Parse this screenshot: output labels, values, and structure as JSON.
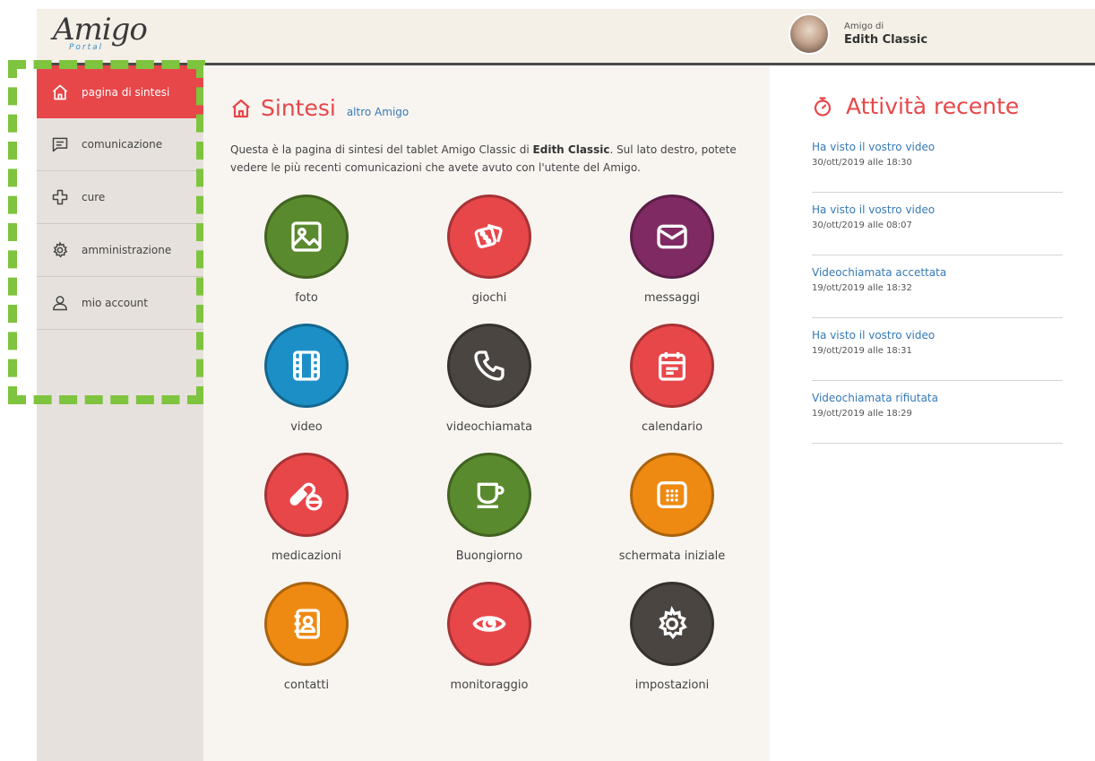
{
  "brand": {
    "logo": "Amigo",
    "sub": "Portal"
  },
  "user": {
    "label": "Amigo di",
    "name": "Edith Classic"
  },
  "sidebar": {
    "items": [
      {
        "label": "pagina di sintesi",
        "icon": "home-icon"
      },
      {
        "label": "comunicazione",
        "icon": "chat-icon"
      },
      {
        "label": "cure",
        "icon": "care-icon"
      },
      {
        "label": "amministrazione",
        "icon": "gear-icon"
      },
      {
        "label": "mio account",
        "icon": "user-icon"
      }
    ]
  },
  "main": {
    "title": "Sintesi",
    "title_link": "altro Amigo",
    "intro_part1": "Questa è la pagina di sintesi del tablet Amigo Classic di ",
    "intro_bold": "Edith Classic",
    "intro_part2": ". Sul lato destro, potete vedere le più recenti comunicazioni che avete avuto con l'utente del Amigo.",
    "tiles": [
      {
        "label": "foto",
        "color": "#5a8a2e",
        "icon": "photo-icon"
      },
      {
        "label": "giochi",
        "color": "#e8474a",
        "icon": "dice-icon"
      },
      {
        "label": "messaggi",
        "color": "#7f2a63",
        "icon": "mail-icon"
      },
      {
        "label": "video",
        "color": "#1c8fc6",
        "icon": "film-icon"
      },
      {
        "label": "videochiamata",
        "color": "#4a4540",
        "icon": "phone-icon"
      },
      {
        "label": "calendario",
        "color": "#e8474a",
        "icon": "calendar-icon"
      },
      {
        "label": "medicazioni",
        "color": "#e8474a",
        "icon": "pill-icon"
      },
      {
        "label": "Buongiorno",
        "color": "#5a8a2e",
        "icon": "coffee-icon"
      },
      {
        "label": "schermata iniziale",
        "color": "#ee8a12",
        "icon": "apps-icon"
      },
      {
        "label": "contatti",
        "color": "#ee8a12",
        "icon": "contacts-icon"
      },
      {
        "label": "monitoraggio",
        "color": "#e8474a",
        "icon": "eye-icon"
      },
      {
        "label": "impostazioni",
        "color": "#4a4540",
        "icon": "gear-icon"
      }
    ]
  },
  "activity": {
    "title": "Attività recente",
    "items": [
      {
        "title": "Ha visto il vostro video",
        "time": "30/ott/2019 alle 18:30"
      },
      {
        "title": "Ha visto il vostro video",
        "time": "30/ott/2019 alle 08:07"
      },
      {
        "title": "Videochiamata accettata",
        "time": "19/ott/2019 alle 18:32"
      },
      {
        "title": "Ha visto il vostro video",
        "time": "19/ott/2019 alle 18:31"
      },
      {
        "title": "Videochiamata rifiutata",
        "time": "19/ott/2019 alle 18:29"
      }
    ]
  },
  "colors": {
    "accent": "#e8474a",
    "link": "#3579b8",
    "highlight": "#7ec43e"
  }
}
